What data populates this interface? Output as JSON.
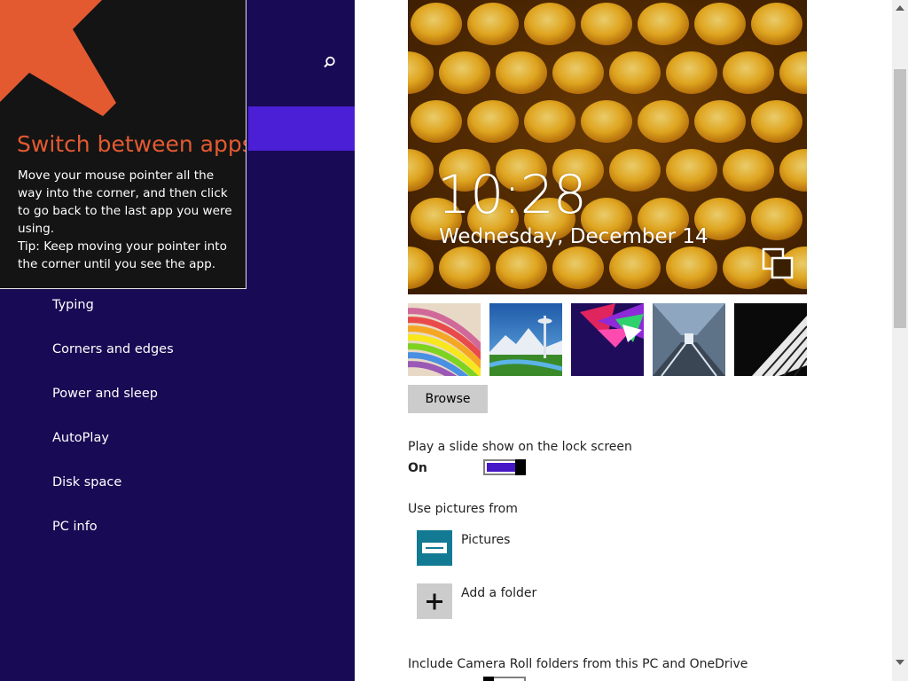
{
  "colors": {
    "nav_background": "#180a54",
    "nav_selected": "#4b1fd6",
    "tip_background": "#141414",
    "tip_title": "#e35a31",
    "toggle_on": "#4617c7",
    "pictures_tile": "#137a94",
    "add_tile": "#cccccc"
  },
  "nav": {
    "search_icon": "search-icon",
    "items": [
      {
        "label": "Typing"
      },
      {
        "label": "Corners and edges"
      },
      {
        "label": "Power and sleep"
      },
      {
        "label": "AutoPlay"
      },
      {
        "label": "Disk space"
      },
      {
        "label": "PC info"
      }
    ]
  },
  "tip": {
    "title": "Switch between apps",
    "body_line1": "Move your mouse pointer all the way into the corner, and then click to go back to the last app you were using.",
    "body_line2": "Tip: Keep moving your pointer into the corner until you see the app."
  },
  "lock_preview": {
    "time": "10:28",
    "date": "Wednesday, December 14"
  },
  "browse": {
    "label": "Browse"
  },
  "slideshow": {
    "label": "Play a slide show on the lock screen",
    "state": "On",
    "enabled": true
  },
  "sources": {
    "label": "Use pictures from",
    "items": [
      {
        "label": "Pictures",
        "icon": "pictures-library-icon"
      },
      {
        "label": "Add a folder",
        "icon": "plus-icon"
      }
    ]
  },
  "camera_roll": {
    "label": "Include Camera Roll folders from this PC and OneDrive",
    "enabled": false
  }
}
